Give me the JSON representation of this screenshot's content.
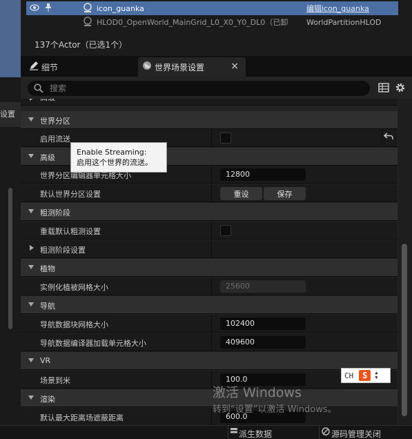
{
  "left_panel": {
    "tab_label": "设置"
  },
  "outliner": {
    "rows": [
      {
        "name": "icon_guanka",
        "type": "编辑icon_guanka"
      },
      {
        "name": "HLOD0_OpenWorld_MainGrid_L0_X0_Y0_DL0（已卸",
        "type": "WorldPartitionHLOD"
      }
    ],
    "actor_count": "137个Actor（已选1个）"
  },
  "tabs": {
    "details": "细节",
    "world_settings": "世界场景设置",
    "close": "×"
  },
  "search": {
    "placeholder": "搜索"
  },
  "properties": {
    "partial_top": "高级",
    "world_partition": "世界分区",
    "enable_streaming": "启用流送",
    "advanced": "高级",
    "cell_size_label": "世界分区编辑器单元格大小",
    "cell_size_value": "12800",
    "default_settings": "默认世界分区设置",
    "reset_btn": "重设",
    "save_btn": "保存",
    "coarse_phase": "粗测阶段",
    "override_coarse": "重载默认粗测设置",
    "coarse_settings": "粗测阶段设置",
    "foliage": "植物",
    "instanced_grid": "实例化植被网格大小",
    "instanced_grid_value": "25600",
    "navigation": "导航",
    "nav_tile_size": "导航数据块网格大小",
    "nav_tile_value": "102400",
    "nav_loader_size": "导航数据编译器加载单元格大小",
    "nav_loader_value": "409600",
    "vr": "VR",
    "world_to_meters": "场景到米",
    "world_to_meters_value": "100.0",
    "rendering": "渲染",
    "default_max_distance": "默认最大距离场遮蔽距离",
    "default_max_distance_value": "600.0"
  },
  "tooltip": {
    "line1": "Enable Streaming:",
    "line2": "启用这个世界的流送。"
  },
  "ime": {
    "lang": "CH",
    "logo": "S"
  },
  "watermark": {
    "line1": "激活 Windows",
    "line2": "转到“设置”以激活 Windows。"
  },
  "bottom": {
    "derived_data": "派生数据",
    "source_control": "源码管理关闭"
  },
  "colors": {
    "selection": "#4b6fa3",
    "panel_bg": "#232323",
    "category_bg": "#2f2f2f"
  }
}
